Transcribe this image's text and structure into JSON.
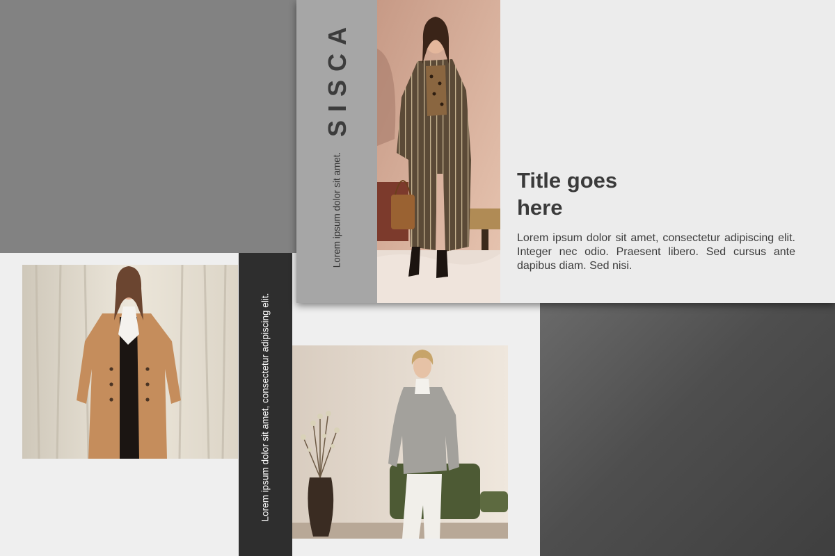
{
  "brand": {
    "name": "SISCA",
    "tagline": "Lorem ipsum dolor sit amet."
  },
  "content": {
    "title": "Title goes here",
    "body": "Lorem ipsum dolor sit amet, consectetur adipiscing elit. Integer nec odio. Praesent libero. Sed cursus ante dapibus diam. Sed nisi."
  },
  "side_strip": {
    "text": "Lorem ipsum dolor sit amet, consectetur adipiscing elit."
  },
  "colors": {
    "background": "#ededed",
    "gray_block": "#828282",
    "dark_block": "#4e4e4e",
    "brand_strip": "#a6a6a6",
    "dark_strip": "#2e2e2e",
    "text_dark": "#3a3a3a"
  },
  "images": [
    {
      "id": "photo-striped-coat",
      "subject": "model in long brown striped coat holding a handbag"
    },
    {
      "id": "photo-camel-coat",
      "subject": "model in camel double-breasted coat in front of curtains"
    },
    {
      "id": "photo-gray-jacket",
      "subject": "model in gray jacket leaning on a green chair beside a vase with dried branches"
    }
  ]
}
